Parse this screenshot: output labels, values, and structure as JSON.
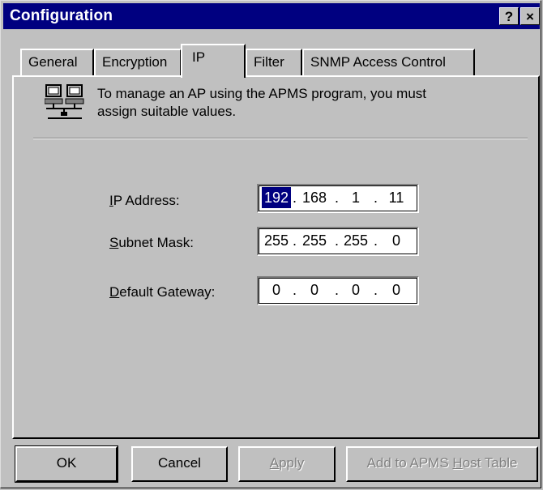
{
  "window": {
    "title": "Configuration",
    "help_button": "?",
    "close_button": "×"
  },
  "tabs": [
    {
      "label": "General",
      "active": false
    },
    {
      "label": "Encryption",
      "active": false
    },
    {
      "label": "IP",
      "active": true
    },
    {
      "label": "Filter",
      "active": false
    },
    {
      "label": "SNMP Access Control",
      "active": false
    }
  ],
  "info": {
    "icon": "network-computers-icon",
    "text_line1": "To manage an AP using the APMS program, you must",
    "text_line2": "assign suitable values."
  },
  "fields": {
    "ip_address": {
      "label": "IP Address:",
      "octets": [
        "192",
        "168",
        "1",
        "11"
      ],
      "selected_octet": 0
    },
    "subnet_mask": {
      "label": "Subnet Mask:",
      "octets": [
        "255",
        "255",
        "255",
        "0"
      ]
    },
    "default_gateway": {
      "label": "Default Gateway:",
      "octets": [
        "0",
        "0",
        "0",
        "0"
      ]
    }
  },
  "buttons": {
    "ok": "OK",
    "cancel": "Cancel",
    "apply": "Apply",
    "add_host": "Add to APMS Host Table"
  },
  "colors": {
    "titlebar": "#000080",
    "face": "#c0c0c0",
    "selection": "#000080"
  }
}
